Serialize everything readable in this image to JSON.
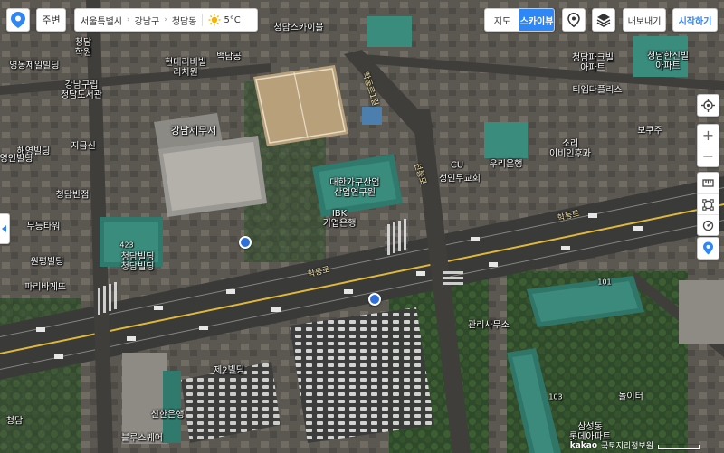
{
  "toolbar": {
    "home_label": "주변",
    "breadcrumb": [
      "서울특별시",
      "강남구",
      "청담동"
    ],
    "weather_temp": "5°C",
    "weather_icon": "sun-icon",
    "map_type_options": [
      "지도",
      "스카이뷰"
    ],
    "map_type_selected": "스카이뷰",
    "export_label": "내보내기",
    "start_label": "시작하기",
    "accent_color": "#2f86f5"
  },
  "zoom": {
    "in_label": "+",
    "out_label": "−"
  },
  "map_labels": [
    {
      "id": "cheongdam-skyblue",
      "text": "청담스카이블"
    },
    {
      "id": "academy",
      "text": "청담\n학원"
    },
    {
      "id": "young-dong-jeil",
      "text": "영동제일빌딩"
    },
    {
      "id": "gangnam-gu-library",
      "text": "강남구립\n청담도서관"
    },
    {
      "id": "hyundai-daejo",
      "text": "현대리버빌\n리치원"
    },
    {
      "id": "baekdam",
      "text": "백담공"
    },
    {
      "id": "cheongdam-park",
      "text": "청담파크빌\n아파트"
    },
    {
      "id": "ceongdam-apartment",
      "text": "청담한신빌\n아파트"
    },
    {
      "id": "teheran",
      "text": "티엠다플리스"
    },
    {
      "id": "haeyeong",
      "text": "해영빌딩"
    },
    {
      "id": "jigeumsin",
      "text": "지금신"
    },
    {
      "id": "yeongin",
      "text": "영인빌딩"
    },
    {
      "id": "gangnam-tax",
      "text": "강남세무서"
    },
    {
      "id": "cu",
      "text": "CU"
    },
    {
      "id": "wooribank",
      "text": "우리은행"
    },
    {
      "id": "sori",
      "text": "소리\n이비인후과"
    },
    {
      "id": "bokjusu",
      "text": "보쿠주"
    },
    {
      "id": "seongin",
      "text": "성인무교회"
    },
    {
      "id": "cheongdam-banjum",
      "text": "청담반점"
    },
    {
      "id": "korea-furniture",
      "text": "대한가구산업\n산업연구원"
    },
    {
      "id": "ibk",
      "text": "IBK\n기업은행"
    },
    {
      "id": "mudeung",
      "text": "무등타워"
    },
    {
      "id": "yeonpyeong",
      "text": "원평빌딩"
    },
    {
      "id": "cheongdam-building",
      "text": "청담빌딩\n청담빌딩"
    },
    {
      "id": "paris-baguette",
      "text": "파리바게뜨"
    },
    {
      "id": "management",
      "text": "관리사무소"
    },
    {
      "id": "jejupark",
      "text": "제2빌딩"
    },
    {
      "id": "shinhan",
      "text": "신한은행"
    },
    {
      "id": "playground",
      "text": "놀이터"
    },
    {
      "id": "samsung-lotte",
      "text": "삼성동\n롯데아파트"
    },
    {
      "id": "bluesquare",
      "text": "블루스퀘어"
    },
    {
      "id": "cheongdam-lobby",
      "text": "청담"
    },
    {
      "id": "num-423a",
      "text": "423"
    },
    {
      "id": "num-101",
      "text": "101"
    },
    {
      "id": "num-103",
      "text": "103"
    }
  ],
  "road_labels": [
    {
      "id": "road-hakdong",
      "text": "학동로"
    },
    {
      "id": "road-hakdong2",
      "text": "학동로"
    },
    {
      "id": "road-v1",
      "text": "학동로1길"
    },
    {
      "id": "road-v2",
      "text": "선릉로"
    }
  ],
  "copyright": {
    "brand": "kakao",
    "text": "국토지리정보원"
  }
}
